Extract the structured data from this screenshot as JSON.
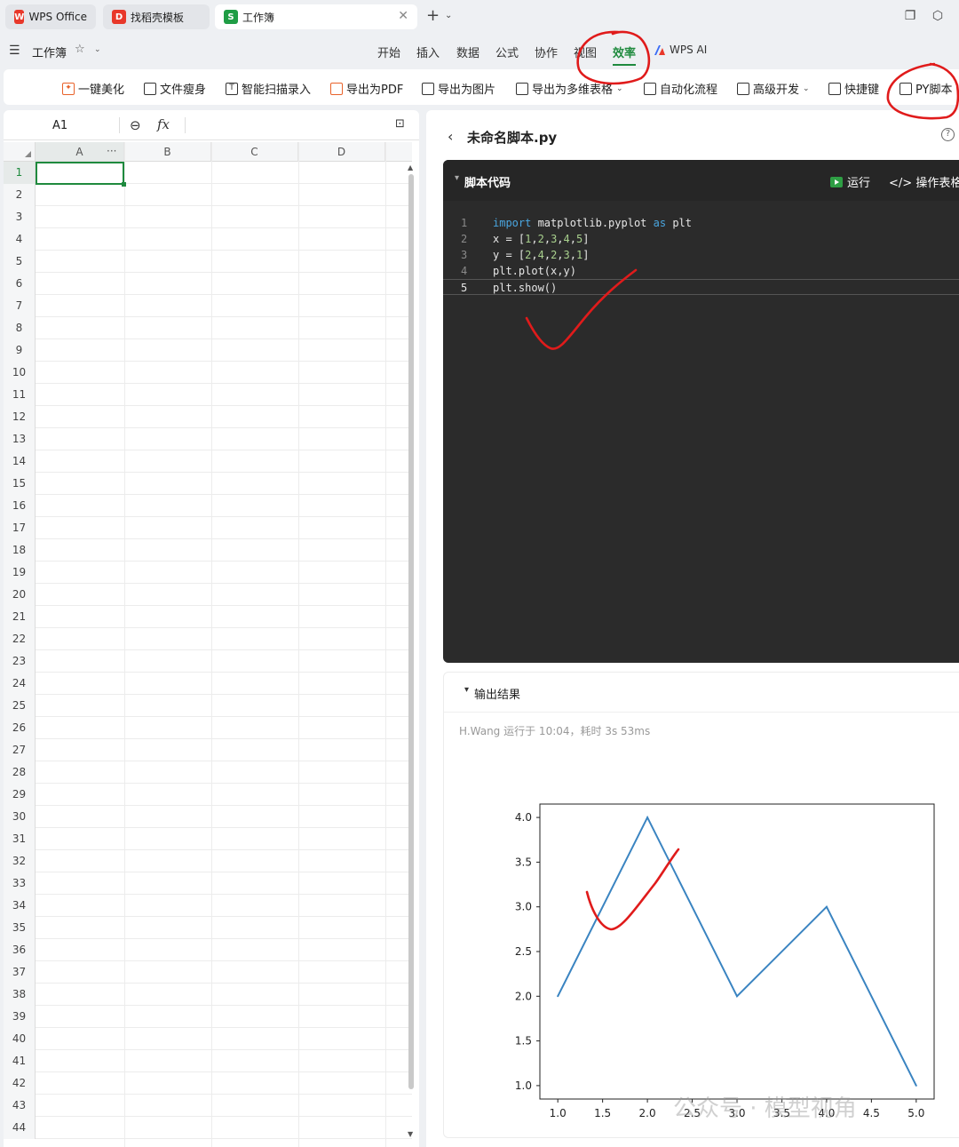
{
  "tabs": [
    {
      "label": "WPS Office",
      "logo": "W",
      "color": "#e8382a"
    },
    {
      "label": "找稻壳模板",
      "logo": "D",
      "color": "#e8382a"
    },
    {
      "label": "工作簿",
      "logo": "S",
      "color": "#1f9d45"
    }
  ],
  "topbar": {
    "new_tab": "+",
    "workbook_name": "工作簿"
  },
  "menu": [
    "开始",
    "插入",
    "数据",
    "公式",
    "协作",
    "视图",
    "效率",
    "WPS AI"
  ],
  "menu_active": "效率",
  "toolbar": [
    {
      "label": "一键美化",
      "icon": "sparkle-icon"
    },
    {
      "label": "文件瘦身",
      "icon": "file-slim-icon"
    },
    {
      "label": "智能扫描录入",
      "icon": "scan-icon"
    },
    {
      "label": "导出为PDF",
      "icon": "export-pdf-icon"
    },
    {
      "label": "导出为图片",
      "icon": "export-image-icon"
    },
    {
      "label": "导出为多维表格",
      "icon": "export-table-icon"
    },
    {
      "label": "自动化流程",
      "icon": "automation-icon"
    },
    {
      "label": "高级开发",
      "icon": "dev-icon"
    },
    {
      "label": "快捷键",
      "icon": "keyboard-icon"
    },
    {
      "label": "PY脚本",
      "icon": "py-script-icon"
    }
  ],
  "sheet": {
    "cell_ref": "A1",
    "fx": "fx",
    "columns": [
      "A",
      "B",
      "C",
      "D"
    ],
    "col_more": "···",
    "rows": [
      "1",
      "2",
      "3",
      "4",
      "5",
      "6",
      "7",
      "8",
      "9",
      "10",
      "11",
      "12",
      "13",
      "14",
      "15",
      "16",
      "17",
      "18",
      "19",
      "20",
      "21",
      "22",
      "23",
      "24",
      "25",
      "26",
      "27",
      "28",
      "29",
      "30",
      "31",
      "32",
      "33",
      "34",
      "35",
      "36",
      "37",
      "38",
      "39",
      "40",
      "41",
      "42",
      "43",
      "44"
    ],
    "selected_row": "1"
  },
  "script": {
    "name": "未命名脚本.py",
    "code_title": "脚本代码",
    "run_label": "运行",
    "op_label": "操作表格区",
    "lines": [
      {
        "n": "1",
        "parts": [
          {
            "t": "import",
            "c": "kw"
          },
          {
            "t": " matplotlib.pyplot ",
            "c": ""
          },
          {
            "t": "as",
            "c": "kw"
          },
          {
            "t": " plt",
            "c": ""
          }
        ]
      },
      {
        "n": "2",
        "parts": [
          {
            "t": "x = [",
            "c": ""
          },
          {
            "t": "1",
            "c": "num"
          },
          {
            "t": ",",
            "c": ""
          },
          {
            "t": "2",
            "c": "num"
          },
          {
            "t": ",",
            "c": ""
          },
          {
            "t": "3",
            "c": "num"
          },
          {
            "t": ",",
            "c": ""
          },
          {
            "t": "4",
            "c": "num"
          },
          {
            "t": ",",
            "c": ""
          },
          {
            "t": "5",
            "c": "num"
          },
          {
            "t": "]",
            "c": ""
          }
        ]
      },
      {
        "n": "3",
        "parts": [
          {
            "t": "y = [",
            "c": ""
          },
          {
            "t": "2",
            "c": "num"
          },
          {
            "t": ",",
            "c": ""
          },
          {
            "t": "4",
            "c": "num"
          },
          {
            "t": ",",
            "c": ""
          },
          {
            "t": "2",
            "c": "num"
          },
          {
            "t": ",",
            "c": ""
          },
          {
            "t": "3",
            "c": "num"
          },
          {
            "t": ",",
            "c": ""
          },
          {
            "t": "1",
            "c": "num"
          },
          {
            "t": "]",
            "c": ""
          }
        ]
      },
      {
        "n": "4",
        "parts": [
          {
            "t": "plt.plot(x,y)",
            "c": ""
          }
        ]
      },
      {
        "n": "5",
        "parts": [
          {
            "t": "plt.show()",
            "c": ""
          }
        ]
      }
    ],
    "current_line": "5"
  },
  "output": {
    "title": "输出结果",
    "meta": "H.Wang 运行于 10:04，耗时 3s 53ms"
  },
  "chart_data": {
    "type": "line",
    "x": [
      1,
      2,
      3,
      4,
      5
    ],
    "series": [
      {
        "values": [
          2,
          4,
          2,
          3,
          1
        ],
        "color": "#3a84c1"
      }
    ],
    "xlim": [
      0.8,
      5.2
    ],
    "ylim": [
      0.85,
      4.15
    ],
    "xticks": [
      "1.0",
      "1.5",
      "2.0",
      "2.5",
      "3.0",
      "3.5",
      "4.0",
      "4.5",
      "5.0"
    ],
    "yticks": [
      "1.0",
      "1.5",
      "2.0",
      "2.5",
      "3.0",
      "3.5",
      "4.0"
    ],
    "grid": false,
    "title": "",
    "xlabel": "",
    "ylabel": ""
  },
  "watermark": "公众号 · 模型视角",
  "colors": {
    "accent": "#1f8a3e",
    "annotation": "#e01b1b",
    "code_bg": "#2b2b2b"
  }
}
